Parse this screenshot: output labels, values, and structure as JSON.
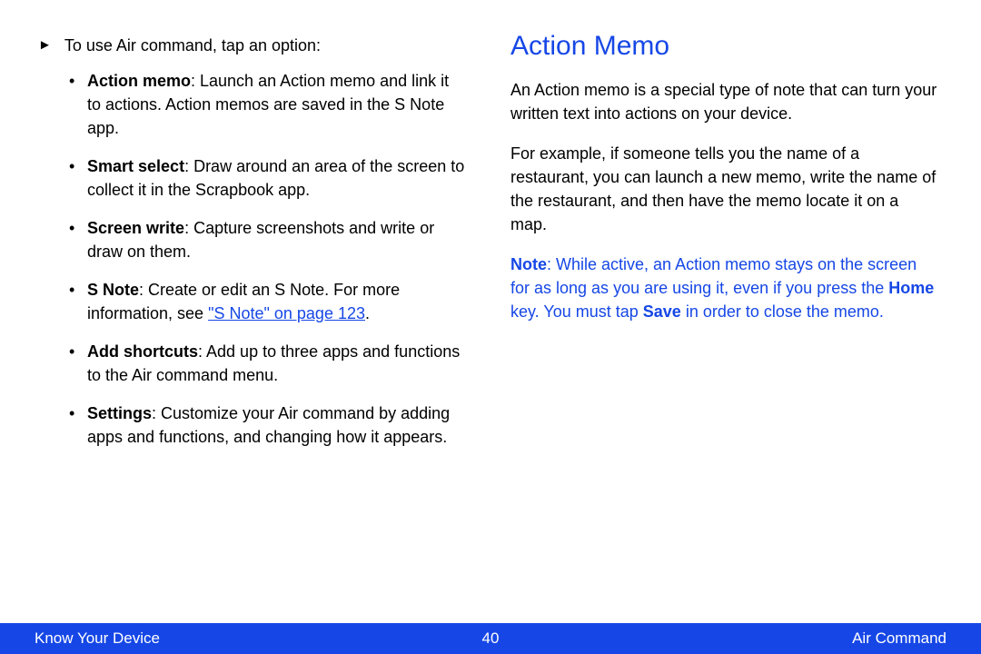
{
  "left": {
    "intro": "To use Air command, tap an option:",
    "pointer": "►",
    "items": [
      {
        "label": "Action memo",
        "text": ": Launch an Action memo and link it to actions. Action memos are saved in the S Note app."
      },
      {
        "label": "Smart select",
        "text": ": Draw around an area of the screen to collect it in the Scrapbook app."
      },
      {
        "label": "Screen write",
        "text": ": Capture screenshots and write or draw on them."
      },
      {
        "label": "S Note",
        "text_before": ": Create or edit an S Note. For more information, see ",
        "link_text": "\"S Note\" on page 123",
        "text_after": "."
      },
      {
        "label": "Add shortcuts",
        "text": ": Add up to three apps and functions to the Air command menu."
      },
      {
        "label": "Settings",
        "text": ": Customize your Air command by adding apps and functions, and changing how it appears."
      }
    ]
  },
  "right": {
    "heading": "Action Memo",
    "para1": "An Action memo is a special type of note that can turn your written text into actions on your device.",
    "para2": "For example, if someone tells you the name of a restaurant, you can launch a new memo, write the name of the restaurant, and then have the memo locate it on a map.",
    "note": {
      "label": "Note",
      "seg1": ": While active, an Action memo stays on the screen for as long as you are using it, even if you press the ",
      "home": "Home",
      "seg2": " key. You must tap ",
      "save": "Save",
      "seg3": " in order to close the memo."
    }
  },
  "footer": {
    "left": "Know Your Device",
    "center": "40",
    "right": "Air Command"
  }
}
